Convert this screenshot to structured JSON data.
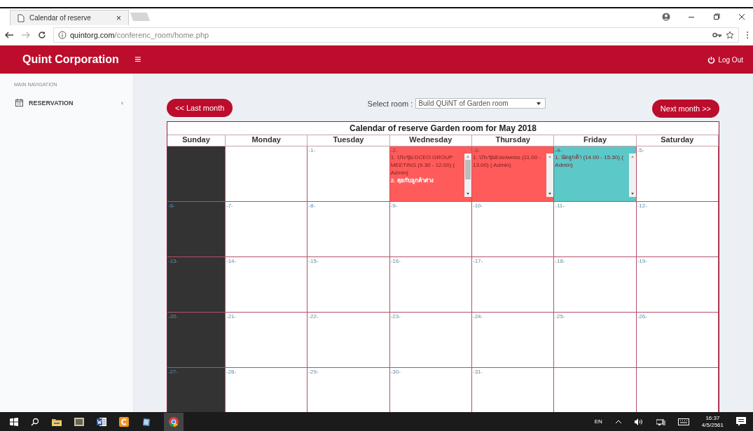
{
  "browser": {
    "tab_title": "Calendar of reserve",
    "tab_close": "×",
    "url": {
      "host": "quintorg.com",
      "path": "/conferenc_room/home.php"
    }
  },
  "header": {
    "brand": "Quint Corporation",
    "menu_glyph": "≡",
    "logout": "Log Out"
  },
  "sidebar": {
    "heading": "MAIN NAVIGATION",
    "items": [
      {
        "label": "RESERVATION",
        "caret": "‹",
        "expanded": false
      }
    ]
  },
  "toolbar": {
    "prev_button": "<< Last month",
    "room_label": "Select room :",
    "room_value": "Build QUiNT of Garden room",
    "next_button": "Next month >>"
  },
  "calendar": {
    "title": "Calendar of reserve Garden room for May 2018",
    "weekdays": [
      "Sunday",
      "Monday",
      "Tuesday",
      "Wednesday",
      "Thursday",
      "Friday",
      "Saturday"
    ],
    "weeks": [
      {
        "days": [
          {
            "kind": "blank"
          },
          {
            "kind": "blank"
          },
          {
            "kind": "date",
            "label": "-1-"
          },
          {
            "kind": "date",
            "label": "-2-",
            "color": "#ff5b5b",
            "events": [
              {
                "kind": "normal",
                "text": "1. ประชุม DCEO GROUP MEETING (9.30 - 12.00) ( Admin)"
              },
              {
                "kind": "emphasis",
                "text": "2. คุยกับลูกค้าต่าง"
              }
            ]
          },
          {
            "kind": "date",
            "label": "-3-",
            "color": "#ff5b5b",
            "events": [
              {
                "kind": "normal",
                "text": "1. ประชุมEdelweiss (11.00 - 13.00) ( Admin)"
              }
            ]
          },
          {
            "kind": "date",
            "label": "-4-",
            "color": "#5cc8c8",
            "events": [
              {
                "kind": "normal",
                "text": "1. นัดลูกค้า (14.00 - 15.30) ( Admin)"
              }
            ]
          },
          {
            "kind": "date",
            "label": "-5-"
          }
        ]
      },
      {
        "days": [
          {
            "kind": "date",
            "label": "-6-"
          },
          {
            "kind": "date",
            "label": "-7-"
          },
          {
            "kind": "date",
            "label": "-8-"
          },
          {
            "kind": "date",
            "label": "-9-"
          },
          {
            "kind": "date",
            "label": "-10-"
          },
          {
            "kind": "date",
            "label": "-11-"
          },
          {
            "kind": "date",
            "label": "-12-"
          }
        ]
      },
      {
        "days": [
          {
            "kind": "date",
            "label": "-13-"
          },
          {
            "kind": "date",
            "label": "-14-"
          },
          {
            "kind": "date",
            "label": "-15-"
          },
          {
            "kind": "date",
            "label": "-16-"
          },
          {
            "kind": "date",
            "label": "-17-"
          },
          {
            "kind": "date",
            "label": "-18-"
          },
          {
            "kind": "date",
            "label": "-19-"
          }
        ]
      },
      {
        "days": [
          {
            "kind": "date",
            "label": "-20-"
          },
          {
            "kind": "date",
            "label": "-21-"
          },
          {
            "kind": "date",
            "label": "-22-"
          },
          {
            "kind": "date",
            "label": "-23-"
          },
          {
            "kind": "date",
            "label": "-24-"
          },
          {
            "kind": "date",
            "label": "-25-"
          },
          {
            "kind": "date",
            "label": "-26-"
          }
        ]
      },
      {
        "days": [
          {
            "kind": "date",
            "label": "-27-"
          },
          {
            "kind": "date",
            "label": "-28-"
          },
          {
            "kind": "date",
            "label": "-29-"
          },
          {
            "kind": "date",
            "label": "-30-"
          },
          {
            "kind": "date",
            "label": "-31-"
          },
          {
            "kind": "blank"
          },
          {
            "kind": "blank"
          }
        ]
      }
    ]
  },
  "taskbar": {
    "language": "EN",
    "time": "16:37",
    "date": "4/5/2561"
  }
}
